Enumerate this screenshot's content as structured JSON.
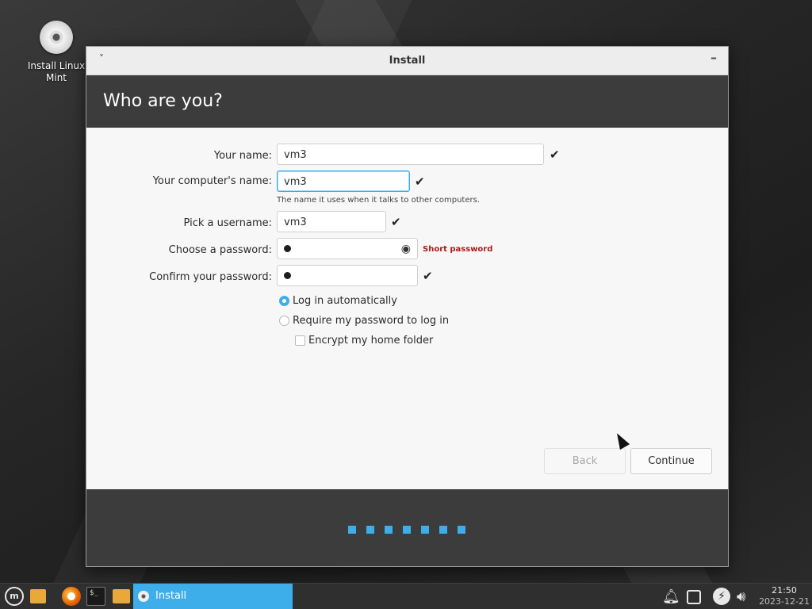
{
  "desktop": {
    "icon_label": "Install Linux Mint"
  },
  "window": {
    "title": "Install",
    "menu_glyph": "˅",
    "minimize_glyph": "–",
    "heading": "Who are you?"
  },
  "form": {
    "your_name": {
      "label": "Your name:",
      "value": "vm3"
    },
    "computer_name": {
      "label": "Your computer's name:",
      "value": "vm3",
      "hint": "The name it uses when it talks to other computers."
    },
    "username": {
      "label": "Pick a username:",
      "value": "vm3"
    },
    "password": {
      "label": "Choose a password:",
      "value": "●",
      "warning": "Short password"
    },
    "confirm_password": {
      "label": "Confirm your password:",
      "value": "●"
    },
    "check_glyph": "✔",
    "eye_glyph": "◉",
    "login_options": [
      {
        "label": "Log in automatically",
        "selected": true
      },
      {
        "label": "Require my password to log in",
        "selected": false
      }
    ],
    "encrypt_home": {
      "label": "Encrypt my home folder",
      "checked": false
    }
  },
  "buttons": {
    "back": "Back",
    "continue": "Continue"
  },
  "progress": {
    "steps": 7,
    "accent": "#3daee9"
  },
  "taskbar": {
    "menu_glyph": "m",
    "terminal_glyph": "$_",
    "active_task": "Install",
    "tray_icons": [
      "bell-icon",
      "window-list-icon",
      "power-icon",
      "volume-icon"
    ],
    "time": "21:50",
    "date": "2023-12-21"
  }
}
